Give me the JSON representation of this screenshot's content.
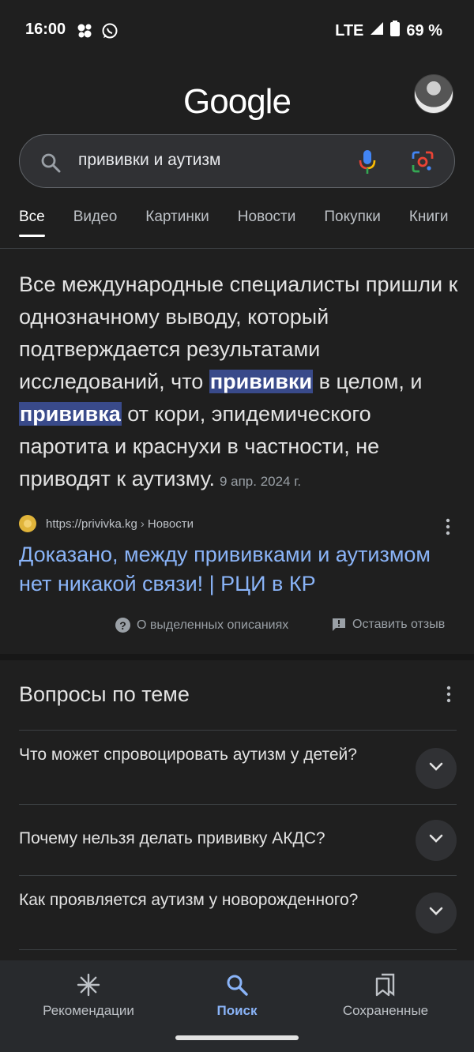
{
  "status_bar": {
    "time": "16:00",
    "left_icons": [
      "notification-dots-icon",
      "whatsapp-icon"
    ],
    "network": "LTE",
    "battery": "69 %"
  },
  "header": {
    "logo": "Google"
  },
  "search": {
    "query": "прививки и аутизм"
  },
  "tabs": [
    "Все",
    "Видео",
    "Картинки",
    "Новости",
    "Покупки",
    "Книги"
  ],
  "snippet": {
    "part1": "Все международные специалисты пришли к однозначному выводу, который подтверждается результатами исследований, что ",
    "highlight1": "прививки",
    "part2": " в целом, и ",
    "highlight2": "прививка",
    "part3": " от кори, эпидемического паротита и краснухи в частности, не приводят к аутизму.",
    "date": "9 апр. 2024 г."
  },
  "source": {
    "url": "https://privivka.kg",
    "separator": "›",
    "section": "Новости"
  },
  "result": {
    "title": "Доказано, между прививками и аутизмом нет никакой связи! | РЦИ в КР"
  },
  "snippet_footer": {
    "about": "О выделенных описаниях",
    "feedback": "Оставить отзыв"
  },
  "related": {
    "title": "Вопросы по теме",
    "questions": [
      "Что может спровоцировать аутизм у детей?",
      "Почему нельзя делать прививку АКДС?",
      "Как проявляется аутизм у новорожденного?"
    ]
  },
  "bottom_nav": {
    "items": [
      "Рекомендации",
      "Поиск",
      "Сохраненные"
    ]
  },
  "colors": {
    "background": "#1f1f1f",
    "link": "#8ab4f8",
    "highlight": "#394a8a"
  }
}
